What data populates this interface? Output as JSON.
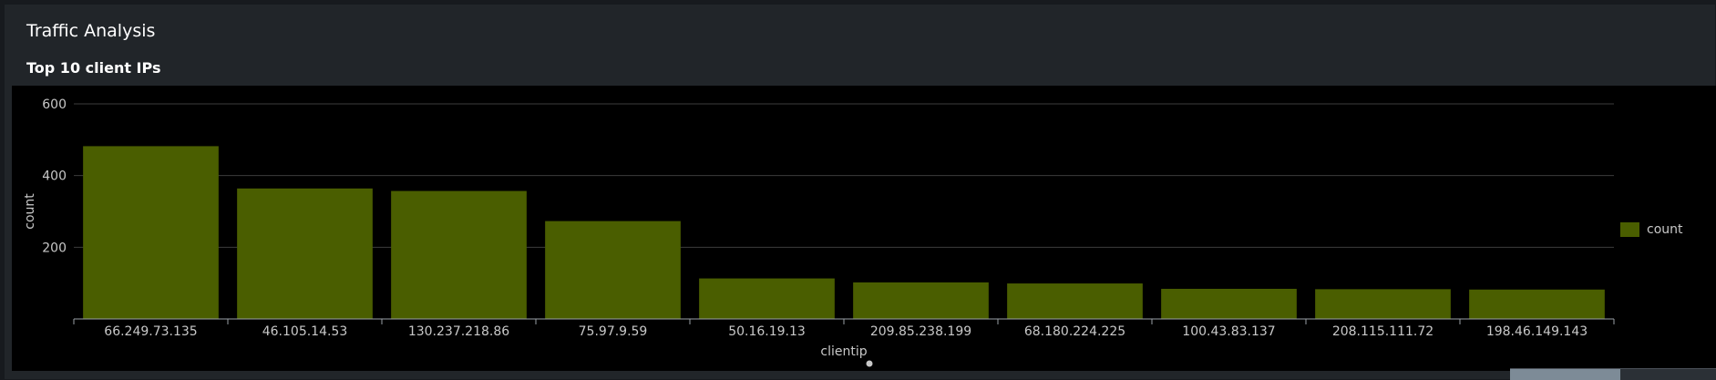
{
  "section": {
    "title": "Traffic Analysis"
  },
  "chart_data": {
    "type": "bar",
    "title": "Top 10 client IPs",
    "xlabel": "clientip",
    "ylabel": "count",
    "ylim": [
      0,
      600
    ],
    "yticks": [
      200,
      400,
      600
    ],
    "grid": true,
    "legend_position": "right",
    "categories": [
      "66.249.73.135",
      "46.105.14.53",
      "130.237.218.86",
      "75.97.9.59",
      "50.16.19.13",
      "209.85.238.199",
      "68.180.224.225",
      "100.43.83.137",
      "208.115.111.72",
      "198.46.149.143"
    ],
    "series": [
      {
        "name": "count",
        "values": [
          482,
          364,
          357,
          273,
          113,
          102,
          99,
          84,
          83,
          82
        ]
      }
    ],
    "colors": {
      "bar": "#4a5e00",
      "axis": "#9aa0a6",
      "grid": "#3c3c3c",
      "text": "#c8c8c8"
    }
  }
}
